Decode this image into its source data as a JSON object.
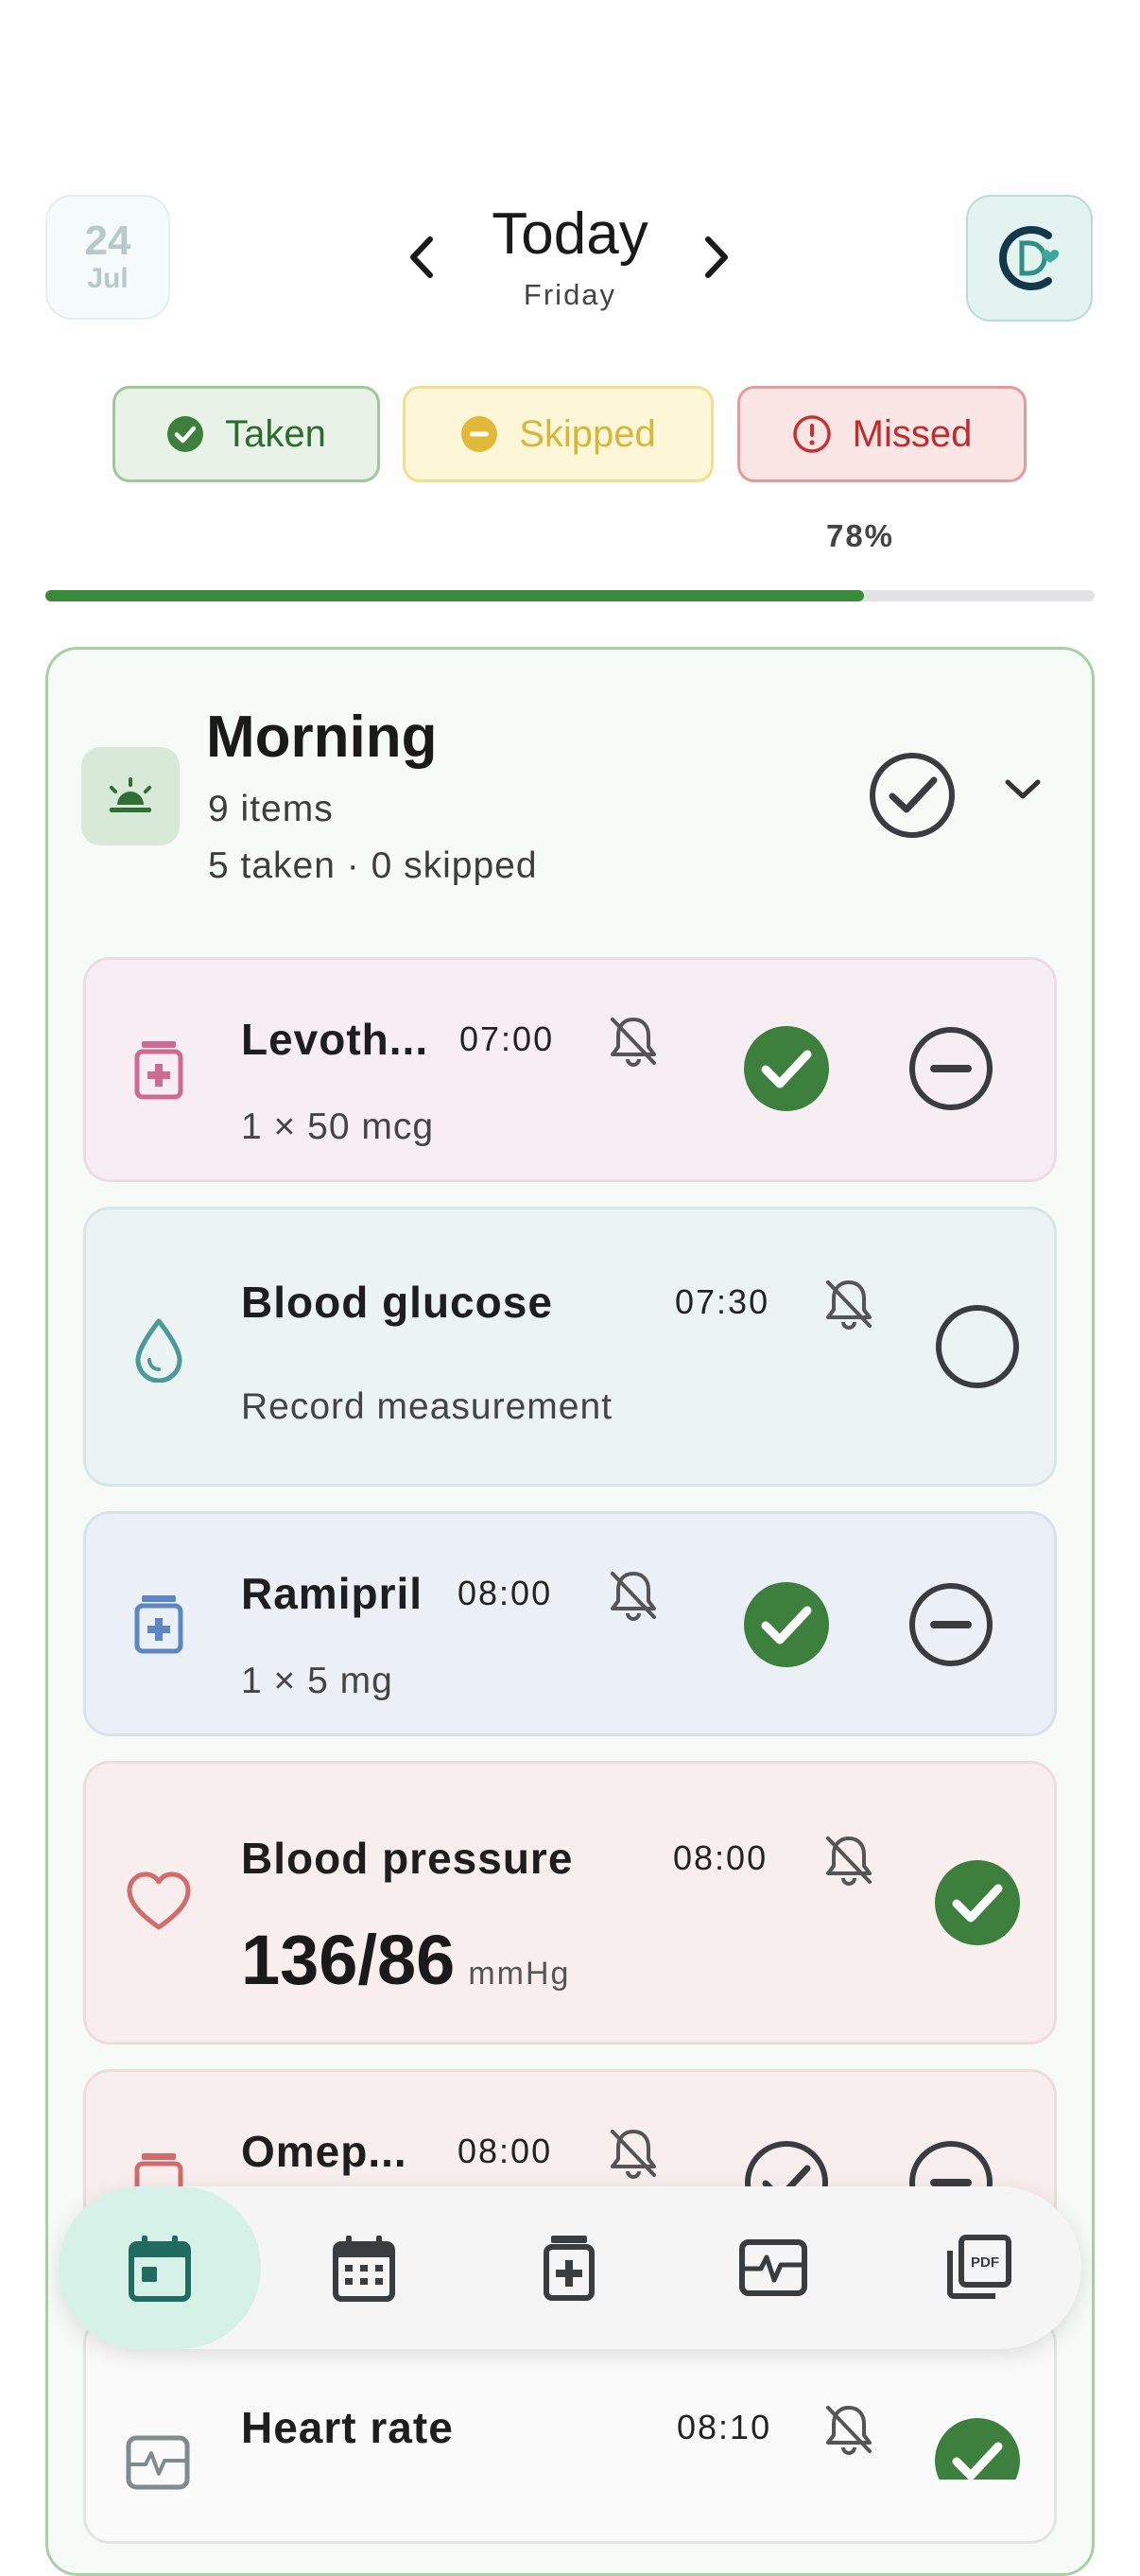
{
  "header": {
    "date_day": "24",
    "date_month": "Jul",
    "title": "Today",
    "weekday": "Friday",
    "icons": {
      "prev": "chevron-left-icon",
      "next": "chevron-right-icon",
      "profile": "profile-logo-icon"
    }
  },
  "status": {
    "taken": "Taken",
    "skipped": "Skipped",
    "missed": "Missed"
  },
  "progress": {
    "label": "78%",
    "value": 0.78
  },
  "group": {
    "title": "Morning",
    "count": "9 items",
    "summary": "5 taken · 0 skipped",
    "icon": "sunrise-icon"
  },
  "items": [
    {
      "name": "Levoth...",
      "time": "07:00",
      "detail": "1 × 50 mcg",
      "type": "medication",
      "state": "taken"
    },
    {
      "name": "Blood glucose",
      "time": "07:30",
      "detail": "Record measurement",
      "type": "measurement",
      "state": "pending"
    },
    {
      "name": "Ramipril",
      "time": "08:00",
      "detail": "1 × 5 mg",
      "type": "medication",
      "state": "taken"
    },
    {
      "name": "Blood pressure",
      "time": "08:00",
      "value": "136/86",
      "unit": "mmHg",
      "type": "measurement",
      "state": "taken"
    },
    {
      "name": "Omep...",
      "time": "08:00",
      "type": "medication",
      "state": "pending"
    },
    {
      "name": "Heart rate",
      "time": "08:10",
      "type": "measurement",
      "state": "taken"
    }
  ],
  "colors": {
    "accent_green": "#3b8a3a",
    "taken_icon": "#3d7f3d",
    "skipped_icon": "#e1b938",
    "missed_icon": "#c63333"
  },
  "bottom_nav": {
    "items": [
      "today-calendar-icon",
      "calendar-grid-icon",
      "medication-icon",
      "vitals-icon",
      "pdf-report-icon"
    ],
    "active": 0
  }
}
